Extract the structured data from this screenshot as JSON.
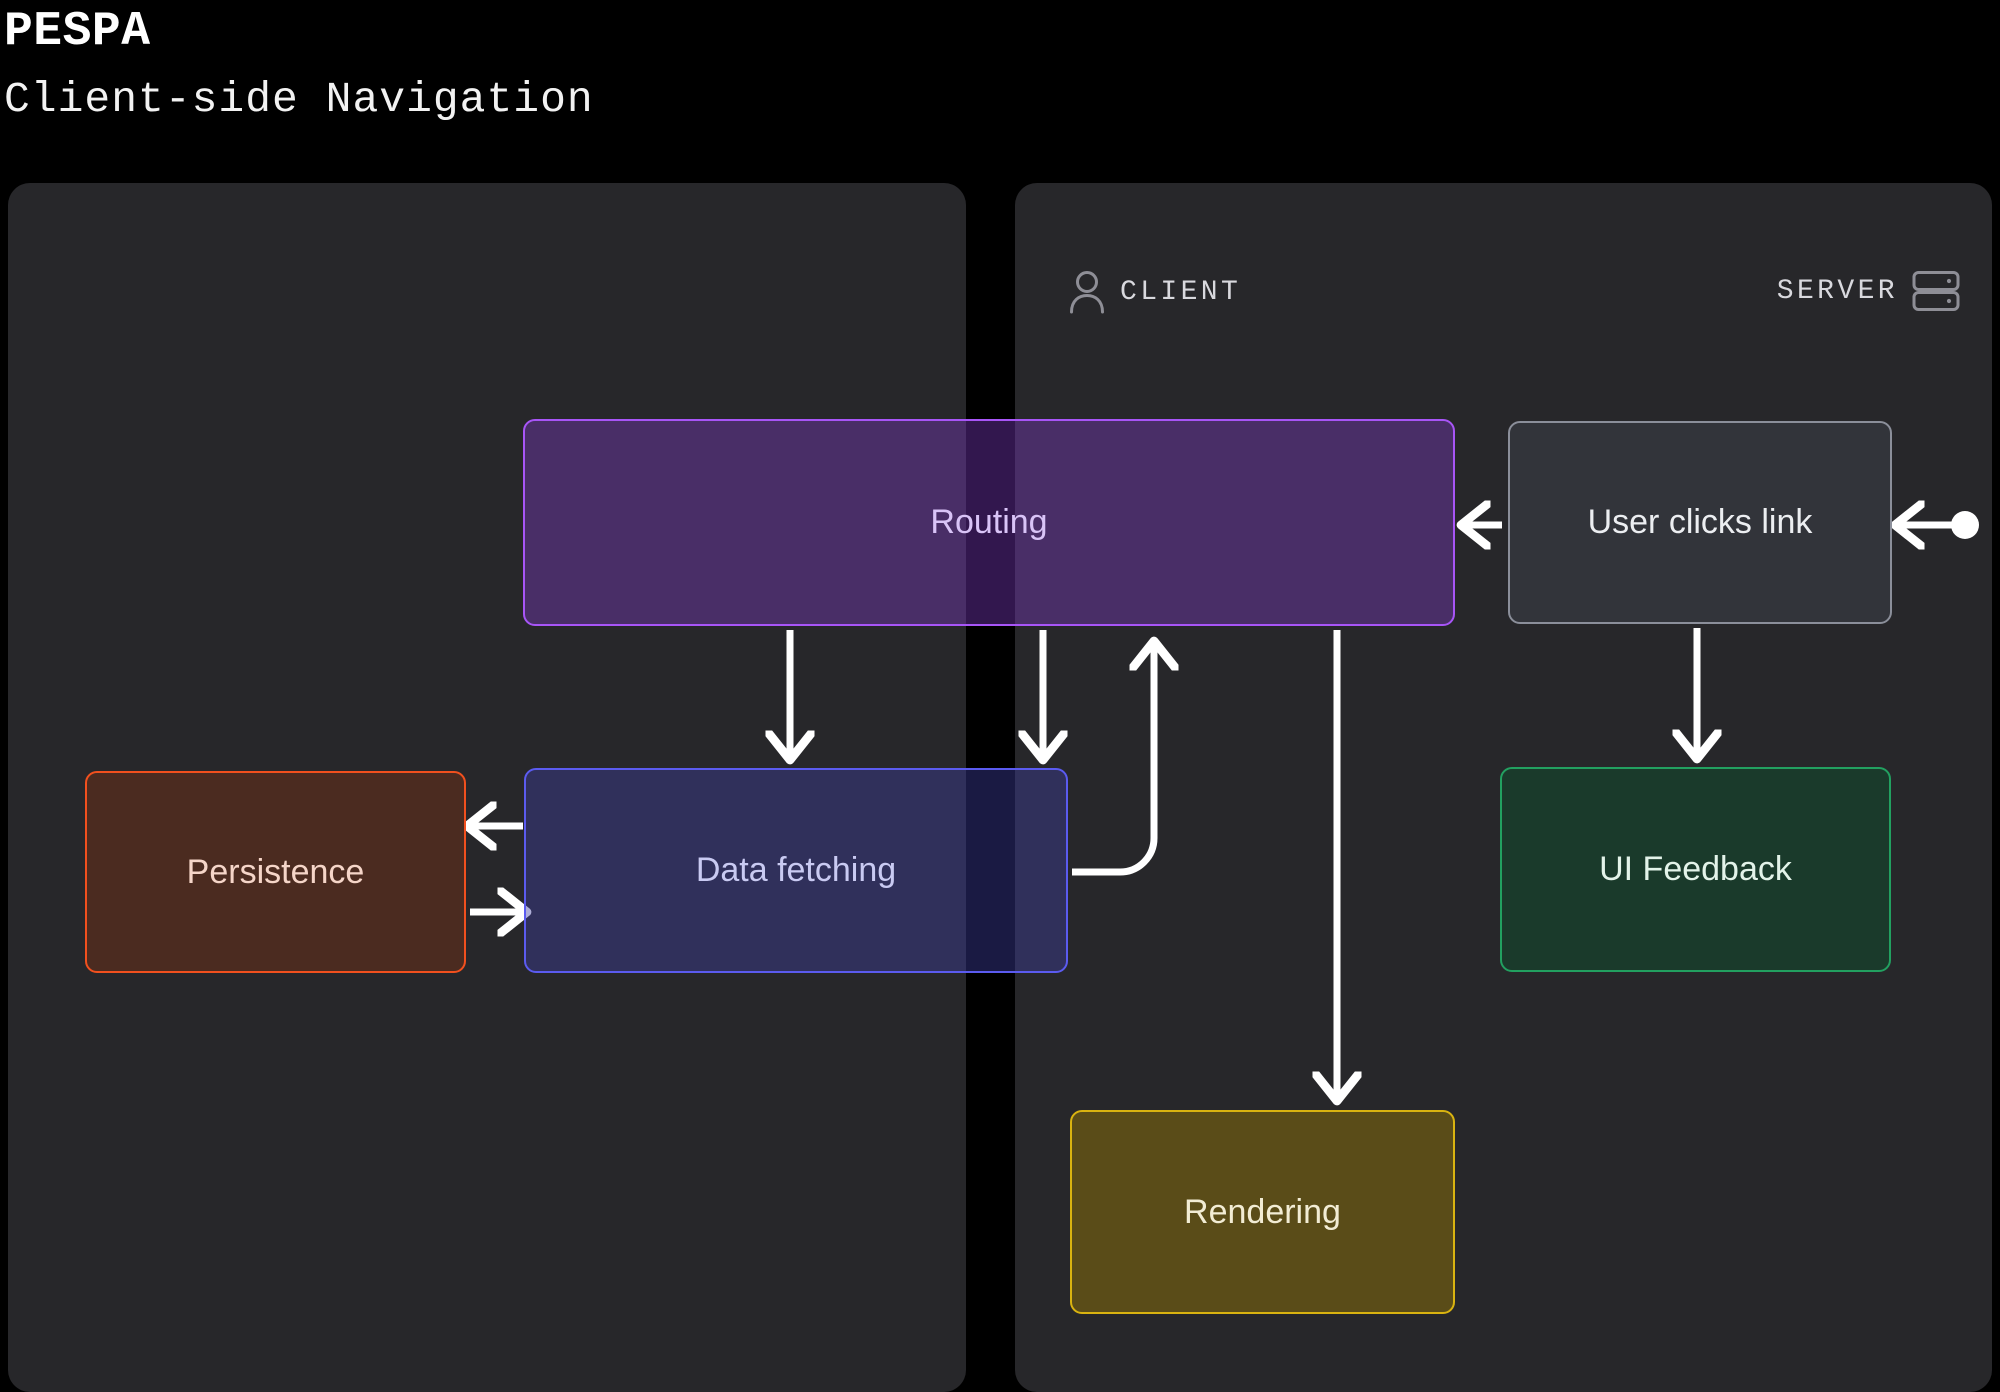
{
  "header": {
    "title": "PESPA",
    "subtitle": "Client-side Navigation"
  },
  "panels": [
    {
      "id": "server",
      "label": "SERVER",
      "icon": "server-icon",
      "icon_position": "right"
    },
    {
      "id": "client",
      "label": "CLIENT",
      "icon": "user-icon",
      "icon_position": "left"
    }
  ],
  "nodes": [
    {
      "id": "routing",
      "label": "Routing",
      "border": "#a855f7",
      "fill": "rgba(124,58,196,0.40)",
      "text": "#d9c4f7",
      "panel": "both"
    },
    {
      "id": "data_fetching",
      "label": "Data fetching",
      "border": "#5b5bf0",
      "fill": "rgba(61,61,160,0.42)",
      "text": "#c9caf2",
      "panel": "both"
    },
    {
      "id": "persistence",
      "label": "Persistence",
      "border": "#f2501e",
      "fill": "#4b2b20",
      "text": "#f5d5c8",
      "panel": "server"
    },
    {
      "id": "user_clicks",
      "label": "User clicks link",
      "border": "#8b8f9a",
      "fill": "#32343a",
      "text": "#eceef1",
      "panel": "client"
    },
    {
      "id": "ui_feedback",
      "label": "UI Feedback",
      "border": "#22a060",
      "fill": "#1a3a2b",
      "text": "#e3f3e9",
      "panel": "client"
    },
    {
      "id": "rendering",
      "label": "Rendering",
      "border": "#d9b310",
      "fill": "#5a4c18",
      "text": "#f2ecd4",
      "panel": "client"
    }
  ],
  "edges": [
    {
      "from": "entry_point",
      "to": "user_clicks",
      "style": "solid",
      "marker_start": "dot",
      "marker_end": "arrow"
    },
    {
      "from": "user_clicks",
      "to": "routing",
      "style": "solid",
      "marker_end": "arrow"
    },
    {
      "from": "user_clicks",
      "to": "ui_feedback",
      "style": "solid",
      "marker_end": "arrow"
    },
    {
      "from": "routing",
      "to": "data_fetching",
      "style": "solid",
      "marker_end": "arrow"
    },
    {
      "from": "routing",
      "to": "data_fetching",
      "style": "solid",
      "marker_end": "arrow"
    },
    {
      "from": "routing",
      "to": "rendering",
      "style": "solid",
      "marker_end": "arrow"
    },
    {
      "from": "data_fetching",
      "to": "routing",
      "style": "curved",
      "marker_end": "arrow"
    },
    {
      "from": "data_fetching",
      "to": "persistence",
      "style": "solid",
      "marker_end": "arrow"
    },
    {
      "from": "persistence",
      "to": "data_fetching",
      "style": "solid",
      "marker_end": "arrow"
    }
  ],
  "theme": {
    "background": "#000000",
    "panel_fill": "#27272a",
    "edge_color": "#ffffff",
    "label_color": "#d9d9de"
  }
}
